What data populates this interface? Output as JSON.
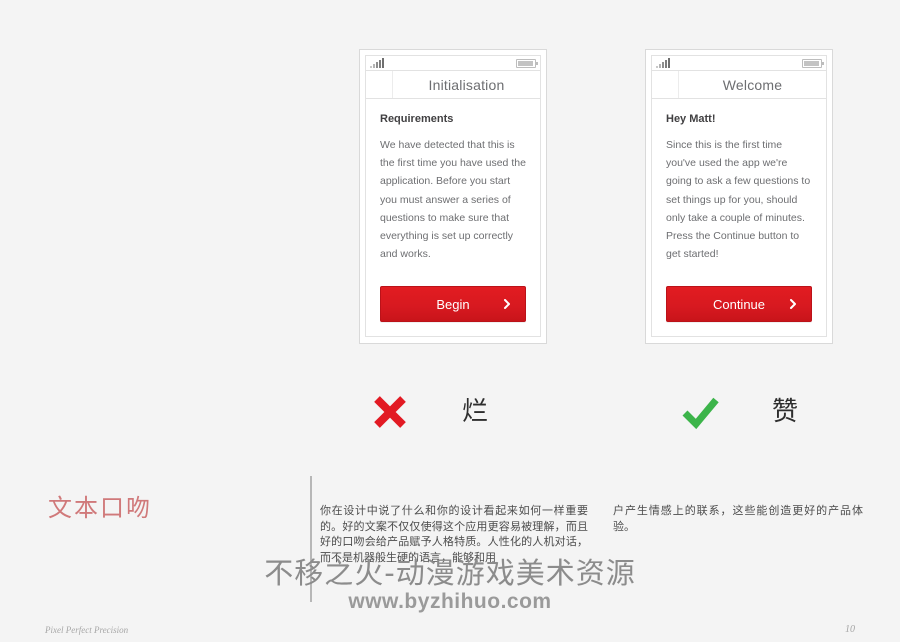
{
  "slide": {
    "footer_left": "Pixel Perfect Precision",
    "page_number": "10",
    "background_color": "#f4f4f4",
    "accent_red": "#d71920"
  },
  "phones": [
    {
      "variant": "bad",
      "statusbar": {
        "signal_icon": "signal-bars-icon",
        "battery_icon": "battery-icon"
      },
      "navbar": {
        "title": "Initialisation",
        "back_icon": "nav-back-slot"
      },
      "screen": {
        "heading": "Requirements",
        "body": "We have detected that this is the first time you have used the application. Before you start you must answer a series of questions to make sure that everything is set up correctly and works."
      },
      "cta": {
        "label": "Begin",
        "chevron_icon": "chevron-right-icon",
        "color": "#d71920"
      }
    },
    {
      "variant": "good",
      "statusbar": {
        "signal_icon": "signal-bars-icon",
        "battery_icon": "battery-icon"
      },
      "navbar": {
        "title": "Welcome",
        "back_icon": "nav-back-slot"
      },
      "screen": {
        "heading": "Hey Matt!",
        "body": "Since this is the first time you've used the app we're going to ask a few questions to set things up for you, should only take a couple of minutes. Press the Continue button to get started!"
      },
      "cta": {
        "label": "Continue",
        "chevron_icon": "chevron-right-icon",
        "color": "#d71920"
      }
    }
  ],
  "verdicts": [
    {
      "icon": "cross-mark-icon",
      "icon_color": "#e21a23",
      "label": "烂"
    },
    {
      "icon": "check-mark-icon",
      "icon_color": "#3cb44a",
      "label": "赞"
    }
  ],
  "annotation": {
    "heading": "文本口吻",
    "heading_color": "#d0797a",
    "columns": [
      "你在设计中说了什么和你的设计看起来如何一样重要的。好的文案不仅仅使得这个应用更容易被理解，而且好的口吻会给产品赋予人格特质。人性化的人机对话，而不是机器般生硬的语言，能够和用",
      "户产生情感上的联系，这些能创造更好的产品体验。"
    ]
  },
  "watermark": {
    "line1": "不移之火-动漫游戏美术资源",
    "line2": "www.byzhihuo.com"
  }
}
